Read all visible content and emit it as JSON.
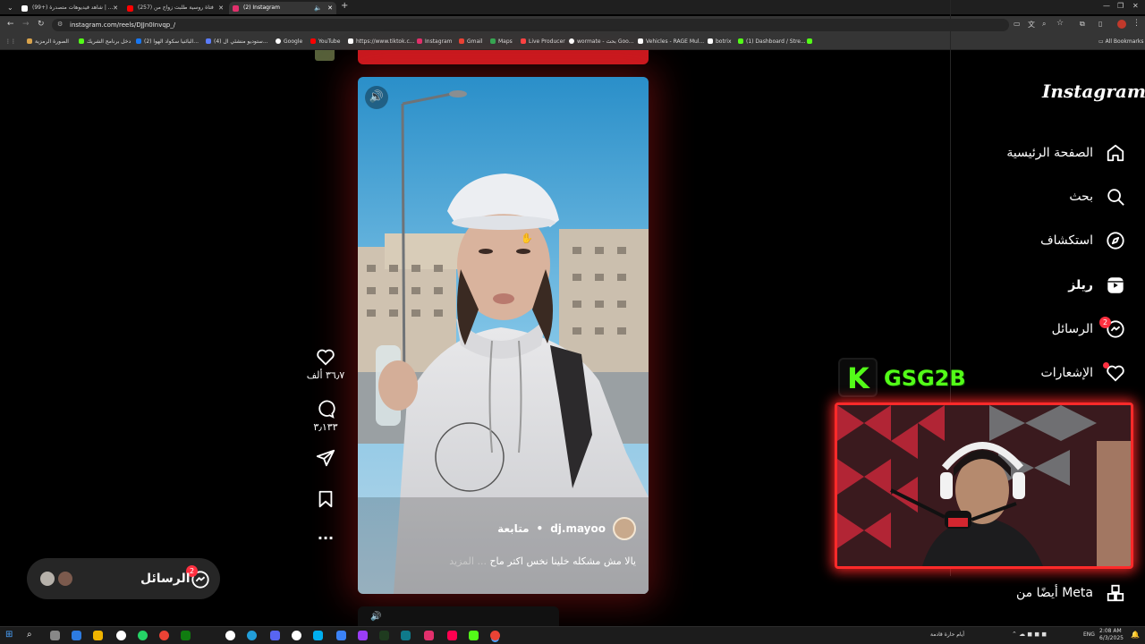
{
  "browser": {
    "tabs": [
      {
        "title": "(99+) شاهد فيديوهات متصدرة | ...",
        "icon_color": "#ffffff"
      },
      {
        "title": "(257) فتاة روسية طلبت زواج من",
        "icon_color": "#ff0000"
      },
      {
        "title": "(2) Instagram",
        "icon_color": "#e1306c"
      }
    ],
    "url": "instagram.com/reels/DJJn0Invqp_/",
    "bookmarks": [
      {
        "label": "الصورة الرمزية",
        "color": "#d9a34b"
      },
      {
        "label": "دخل برنامج الشريك",
        "color": "#53fc18"
      },
      {
        "label": "(2) البائنيا سكواد الهوا...",
        "color": "#1877f2"
      },
      {
        "label": "(4) ستوديو منشئي ال...",
        "color": "#5b7cfa"
      },
      {
        "label": "Google",
        "color": "#ffffff"
      },
      {
        "label": "YouTube",
        "color": "#ff0000"
      },
      {
        "label": "https://www.tiktok.c...",
        "color": "#ffffff"
      },
      {
        "label": "Instagram",
        "color": "#e1306c"
      },
      {
        "label": "Gmail",
        "color": "#ea4335"
      },
      {
        "label": "Maps",
        "color": "#34a853"
      },
      {
        "label": "Live Producer",
        "color": "#ff4444"
      },
      {
        "label": "wormate - بحث Goo...",
        "color": "#ffffff"
      },
      {
        "label": "Vehicles - RAGE Mul...",
        "color": "#ffffff"
      },
      {
        "label": "botrix",
        "color": "#ffffff"
      },
      {
        "label": "(1) Dashboard / Stre...",
        "color": "#53fc18"
      }
    ],
    "all_bookmarks": "All Bookmarks"
  },
  "instagram": {
    "logo": "Instagram",
    "nav": [
      {
        "label": "الصفحة الرئيسية",
        "icon": "home-icon"
      },
      {
        "label": "بحث",
        "icon": "search-icon"
      },
      {
        "label": "استكشاف",
        "icon": "compass-icon"
      },
      {
        "label": "ريلز",
        "icon": "reels-icon"
      },
      {
        "label": "الرسائل",
        "icon": "messenger-icon",
        "badge": "2"
      },
      {
        "label": "الإشعارات",
        "icon": "heart-icon"
      }
    ],
    "more_from_meta": "أيضًا من Meta",
    "reel": {
      "username": "dj.mayoo",
      "follow": "متابعة",
      "caption": "يالا مش مشكله خلينا نخس اكتر ماح",
      "more": "... المزيد"
    },
    "actions": {
      "likes": "٣٦٫٧ ألف",
      "comments": "٣٫١٣٣"
    },
    "messages_pill": {
      "label": "الرسائل",
      "badge": "2"
    }
  },
  "stream_overlay": {
    "channel": "GSG2B",
    "logo_letter": "K",
    "brand_color": "#53fc18"
  },
  "taskbar": {
    "weather_text": "أيام حارة قادمة",
    "lang": "ENG",
    "time": "2:08 AM",
    "date": "6/3/2025"
  }
}
